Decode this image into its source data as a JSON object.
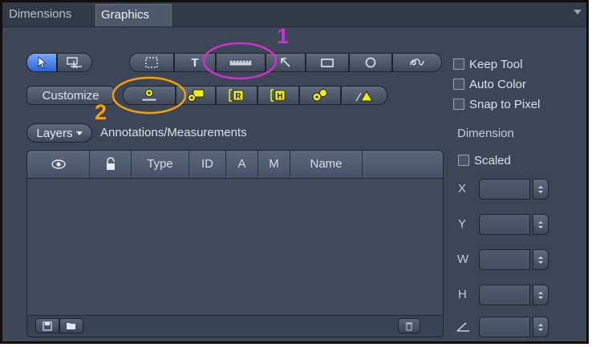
{
  "tabs": [
    {
      "label": "Dimensions",
      "active": false
    },
    {
      "label": "Graphics",
      "active": true
    }
  ],
  "tools_row1": [
    {
      "icon": "arrow-pointer-icon",
      "selected": true
    },
    {
      "icon": "select-region-icon",
      "selected": false
    },
    {
      "icon": "marquee-rect-icon",
      "selected": false
    },
    {
      "icon": "text-tool-icon",
      "label": "T",
      "selected": false
    },
    {
      "icon": "ruler-icon",
      "selected": false
    },
    {
      "icon": "arrow-line-icon",
      "selected": false
    },
    {
      "icon": "rectangle-icon",
      "selected": false
    },
    {
      "icon": "circle-icon",
      "selected": false
    },
    {
      "icon": "freehand-icon",
      "selected": false
    }
  ],
  "customize_label": "Customize",
  "tools_row2": [
    {
      "icon": "scale-bar-marker-icon"
    },
    {
      "icon": "marker-box-icon"
    },
    {
      "icon": "bracket-r-icon"
    },
    {
      "icon": "bracket-h-icon"
    },
    {
      "icon": "marker-event-icon"
    },
    {
      "icon": "triangle-marker-icon"
    }
  ],
  "options": [
    {
      "label": "Keep Tool",
      "checked": false
    },
    {
      "label": "Auto Color",
      "checked": false
    },
    {
      "label": "Snap to Pixel",
      "checked": false
    }
  ],
  "layers_label": "Layers",
  "section_title": "Annotations/Measurements",
  "table": {
    "columns": [
      "eye-icon",
      "lock-icon",
      "Type",
      "ID",
      "A",
      "M",
      "Name"
    ],
    "headers": {
      "type": "Type",
      "id": "ID",
      "a": "A",
      "m": "M",
      "name": "Name"
    },
    "rows": []
  },
  "dimension": {
    "title": "Dimension",
    "scaled_label": "Scaled",
    "fields": [
      {
        "label": "X",
        "value": ""
      },
      {
        "label": "Y",
        "value": ""
      },
      {
        "label": "W",
        "value": ""
      },
      {
        "label": "H",
        "value": ""
      },
      {
        "label": "angle-icon",
        "value": ""
      }
    ]
  },
  "annotations": [
    {
      "label": "1",
      "color": "#cc33cc"
    },
    {
      "label": "2",
      "color": "#f5a000"
    }
  ],
  "colors": {
    "panel_bg": "#3c4657",
    "selected_tool": "#3f78e6",
    "highlight_magenta": "#cc33cc",
    "highlight_orange": "#f5a000",
    "icon_yellow": "#f2f200"
  }
}
